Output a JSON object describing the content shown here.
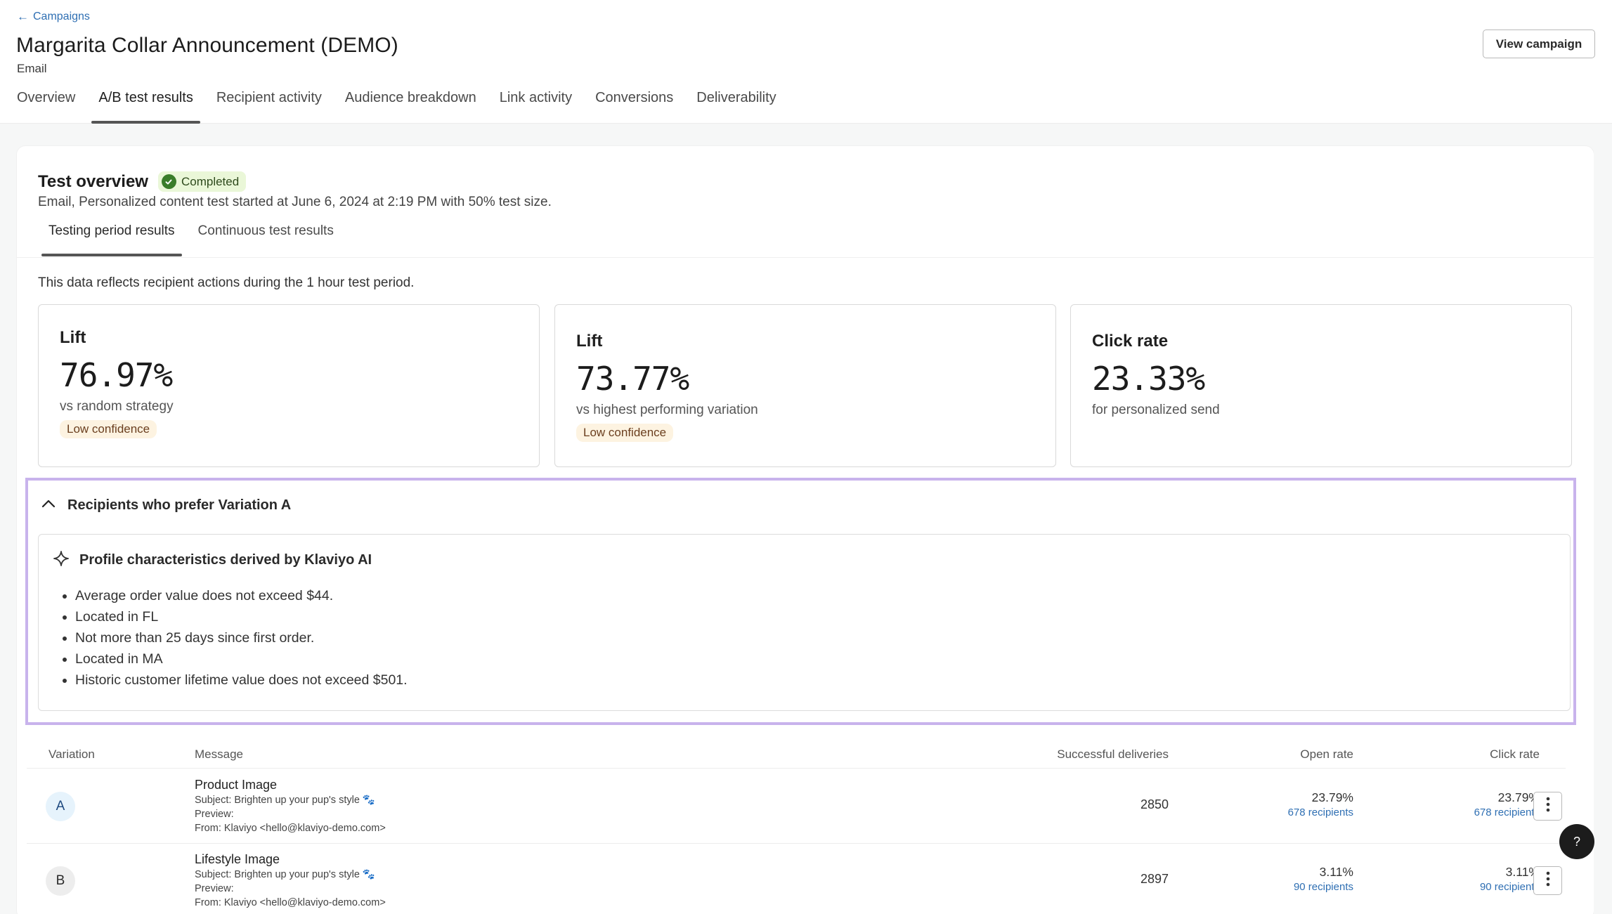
{
  "header": {
    "back_label": "Campaigns",
    "title": "Margarita Collar Announcement (DEMO)",
    "channel": "Email",
    "view_campaign_label": "View campaign",
    "tabs": [
      {
        "label": "Overview",
        "active": false
      },
      {
        "label": "A/B test results",
        "active": true
      },
      {
        "label": "Recipient activity",
        "active": false
      },
      {
        "label": "Audience breakdown",
        "active": false
      },
      {
        "label": "Link activity",
        "active": false
      },
      {
        "label": "Conversions",
        "active": false
      },
      {
        "label": "Deliverability",
        "active": false
      }
    ]
  },
  "overview": {
    "title": "Test overview",
    "status": "Completed",
    "status_color": "#3a7d2a",
    "description": "Email, Personalized content test started at June 6, 2024 at 2:19 PM with 50% test size.",
    "sub_tabs": [
      {
        "label": "Testing period results",
        "active": true
      },
      {
        "label": "Continuous test results",
        "active": false
      }
    ],
    "period_note": "This data reflects recipient actions during the 1 hour test period."
  },
  "metrics": [
    {
      "label": "Lift",
      "value": "76.97%",
      "description": "vs random strategy",
      "confidence": "Low confidence"
    },
    {
      "label": "Lift",
      "value": "73.77%",
      "description": "vs highest performing variation",
      "confidence": "Low confidence"
    },
    {
      "label": "Click rate",
      "value": "23.33%",
      "description": "for personalized send",
      "confidence": null
    }
  ],
  "preference": {
    "title": "Recipients who prefer Variation A",
    "expanded": true,
    "highlight_color": "#c8b3ec",
    "ai_title": "Profile characteristics derived by Klaviyo AI",
    "characteristics": [
      "Average order value does not exceed $44.",
      "Located in FL",
      "Not more than 25 days since first order.",
      "Located in MA",
      "Historic customer lifetime value does not exceed $501."
    ]
  },
  "table": {
    "columns": [
      "Variation",
      "Message",
      "Successful deliveries",
      "Open rate",
      "Click rate"
    ],
    "rows": [
      {
        "variation": "A",
        "message_name": "Product Image",
        "subject": "Subject: Brighten up your pup's style 🐾",
        "preview": "Preview:",
        "from": "From: Klaviyo <hello@klaviyo-demo.com>",
        "deliveries": "2850",
        "open_rate": "23.79%",
        "open_recipients": "678 recipients",
        "click_rate": "23.79%",
        "click_recipients": "678 recipients"
      },
      {
        "variation": "B",
        "message_name": "Lifestyle Image",
        "subject": "Subject: Brighten up your pup's style 🐾",
        "preview": "Preview:",
        "from": "From: Klaviyo <hello@klaviyo-demo.com>",
        "deliveries": "2897",
        "open_rate": "3.11%",
        "open_recipients": "90 recipients",
        "click_rate": "3.11%",
        "click_recipients": "90 recipients"
      }
    ]
  },
  "help_label": "?"
}
